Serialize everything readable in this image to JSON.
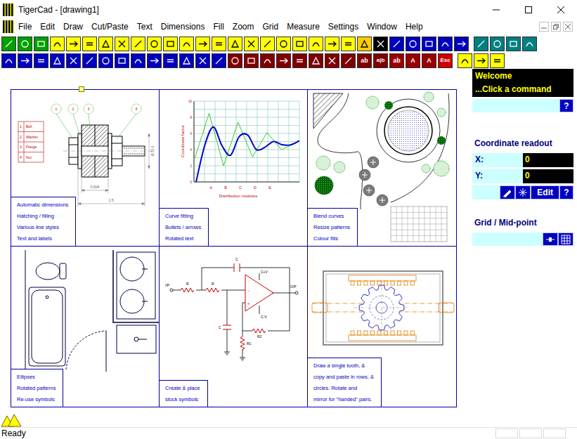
{
  "window": {
    "title": "TigerCad - [drawing1]"
  },
  "menu": [
    "File",
    "Edit",
    "Draw",
    "Cut/Paste",
    "Text",
    "Dimensions",
    "Fill",
    "Zoom",
    "Grid",
    "Measure",
    "Settings",
    "Window",
    "Help"
  ],
  "toolbars": [
    {
      "groups": [
        [
          {
            "color": "#00a000"
          },
          {
            "color": "#00a000"
          },
          {
            "color": "#00a000"
          },
          {
            "color": "#ffff00"
          },
          {
            "color": "#ffff00"
          },
          {
            "color": "#ffff00"
          },
          {
            "color": "#ffff00"
          },
          {
            "color": "#ffff00"
          },
          {
            "color": "#ffff00"
          },
          {
            "color": "#ffff00"
          },
          {
            "color": "#ffff00"
          },
          {
            "color": "#ffff00"
          },
          {
            "color": "#ffff00"
          },
          {
            "color": "#ffff00"
          },
          {
            "color": "#ffff00"
          },
          {
            "color": "#ffff00"
          },
          {
            "color": "#ffff00"
          },
          {
            "color": "#ffff00"
          },
          {
            "color": "#ffff00"
          },
          {
            "color": "#ffff00"
          },
          {
            "color": "#ffff00"
          },
          {
            "color": "#ffff00"
          },
          {
            "color": "#ffcc00"
          },
          {
            "color": "#000000"
          },
          {
            "color": "#0000c0"
          },
          {
            "color": "#0000c0"
          },
          {
            "color": "#0000c0"
          },
          {
            "color": "#0000c0"
          },
          {
            "color": "#0000c0"
          }
        ],
        [
          {
            "color": "#008080"
          },
          {
            "color": "#008080"
          },
          {
            "color": "#008080"
          },
          {
            "color": "#008080"
          }
        ]
      ]
    },
    {
      "groups": [
        [
          {
            "color": "#0000c0"
          },
          {
            "color": "#0000c0"
          },
          {
            "color": "#0000c0"
          },
          {
            "color": "#0000c0"
          },
          {
            "color": "#0000c0"
          },
          {
            "color": "#0000c0"
          },
          {
            "color": "#0000c0"
          },
          {
            "color": "#0000c0"
          },
          {
            "color": "#0000c0"
          },
          {
            "color": "#0000c0"
          },
          {
            "color": "#0000c0"
          },
          {
            "color": "#0000c0"
          },
          {
            "color": "#0000c0"
          },
          {
            "color": "#0000c0"
          },
          {
            "color": "#800000"
          },
          {
            "color": "#800000"
          },
          {
            "color": "#800000"
          },
          {
            "color": "#800000"
          },
          {
            "color": "#800000"
          },
          {
            "color": "#800000"
          },
          {
            "color": "#800000"
          },
          {
            "color": "#800000"
          },
          {
            "color": "#800000",
            "label": "ab"
          },
          {
            "color": "#800000",
            "label": "a|b"
          },
          {
            "color": "#990000",
            "label": "ab"
          },
          {
            "color": "#990000",
            "label": "A"
          },
          {
            "color": "#990000",
            "label": "A"
          },
          {
            "color": "#cc0000",
            "label": "Esc"
          }
        ],
        [
          {
            "color": "#ffff00"
          },
          {
            "color": "#ffff00"
          },
          {
            "color": "#ffff00"
          }
        ]
      ]
    }
  ],
  "drawing": {
    "cells": [
      {
        "kind": "assembly",
        "caption": [
          "Automatic dimensions",
          "Hatching / filling",
          "Various line styles",
          "Text and labels"
        ],
        "parts": [
          {
            "num": "1",
            "name": "Bolt"
          },
          {
            "num": "2",
            "name": "Washer"
          },
          {
            "num": "3",
            "name": "Flange"
          },
          {
            "num": "4",
            "name": "Nut"
          }
        ],
        "balloons": [
          "1",
          "2",
          "3",
          "4"
        ],
        "dimensions": {
          "width": "0.524",
          "length": "1.5",
          "diameter": "Ø 20.0"
        }
      },
      {
        "kind": "chart",
        "caption": [
          "Curve fitting",
          "Bullets / arrows",
          "Rotated text"
        ],
        "y_label": "Coordinate factor",
        "x_label": "Distribution modulus",
        "x_ticks": [
          "A",
          "B",
          "C",
          "D",
          "E"
        ],
        "y_ticks": [
          "0",
          "2",
          "4",
          "6",
          "8",
          "10"
        ],
        "series": [
          {
            "color": "#33cc33",
            "values": [
              2.9,
              8.5,
              2.0,
              7.4,
              3.1,
              6.1,
              4.0,
              4.8
            ]
          },
          {
            "color": "#0000cc",
            "values": [
              0,
              4.5,
              6.8,
              4.5,
              3.3,
              5.6,
              5.8,
              4.0,
              4.3,
              5.0,
              4.6,
              4.6,
              5.1
            ]
          }
        ]
      },
      {
        "kind": "garden",
        "caption": [
          "Blend curves",
          "Resize patterns",
          "Colour fills"
        ]
      },
      {
        "kind": "bathroom",
        "caption": [
          "Ellipses",
          "Rotated patterns",
          "Re-use symbols"
        ]
      },
      {
        "kind": "circuit",
        "caption": [
          "Create & place",
          "stock symbols"
        ],
        "labels": {
          "input": "I/P",
          "r_a": "R",
          "r_b": "R",
          "c_feedback": "C",
          "supply_pos": "C+V",
          "supply_neg": "C-V",
          "output": "O/P",
          "r2": "R2",
          "r1": "R1",
          "c_ground": "C",
          "inverting": "−",
          "non_inverting": "+"
        }
      },
      {
        "kind": "gears",
        "caption": [
          "Draw a single tooth, &",
          "copy and paste in rows, &",
          "circles. Rotate and",
          "mirror for \"handed\" pairs."
        ]
      }
    ]
  },
  "panel": {
    "welcome": {
      "title": "Welcome",
      "message": "...Click a command",
      "help": "?"
    },
    "coordinates": {
      "title": "Coordinate readout",
      "rows": [
        {
          "label": "X:",
          "value": "0"
        },
        {
          "label": "Y:",
          "value": "0"
        }
      ],
      "edit": "Edit",
      "help": "?"
    },
    "grid": {
      "title": "Grid / Mid-point"
    }
  },
  "status_bar": {
    "text": "Ready"
  }
}
